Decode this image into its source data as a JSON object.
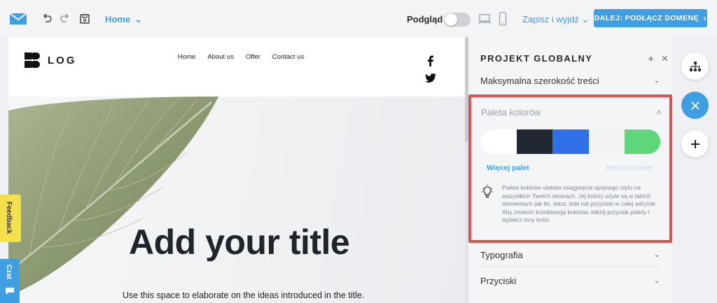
{
  "app": {
    "page_selector": "Home",
    "preview_label": "Podgląd",
    "save_exit_label": "Zapisz i wyjdź",
    "next_button_label": "DALEJ: PODŁĄCZ DOMENĘ",
    "accent_color": "#3ea0e3"
  },
  "site": {
    "logo_text": "LOG",
    "nav": [
      "Home",
      "About us",
      "Offer",
      "Contact us"
    ],
    "hero_title": "Add your title",
    "hero_subtitle": "Use this space to elaborate on the ideas introduced in the title."
  },
  "panel": {
    "title": "PROJEKT GLOBALNY",
    "max_width_label": "Maksymalna szerokość treści",
    "palette": {
      "title": "Paleta kolorów",
      "swatches": [
        "#ffffff",
        "#222831",
        "#2f6fe8",
        "#f2f2f2",
        "#5fd67a"
      ],
      "more_label": "Więcej palet",
      "reset_label": "Resetuj paletę",
      "tip": "Paleta kolorów ułatwia osiągnięcie spójnego stylu na wszystkich Twoich stronach. Jej kolory użyte są w takich elementach jak tło, tekst, linki lub przyciski w całej witrynie. Aby zmienić kombinację kolorów, kliknij przycisk palety i wybierz inny kolor."
    },
    "typography_label": "Typografia",
    "buttons_label": "Przyciski"
  },
  "side_tabs": {
    "feedback": "Feedback",
    "chat": "Czat"
  }
}
